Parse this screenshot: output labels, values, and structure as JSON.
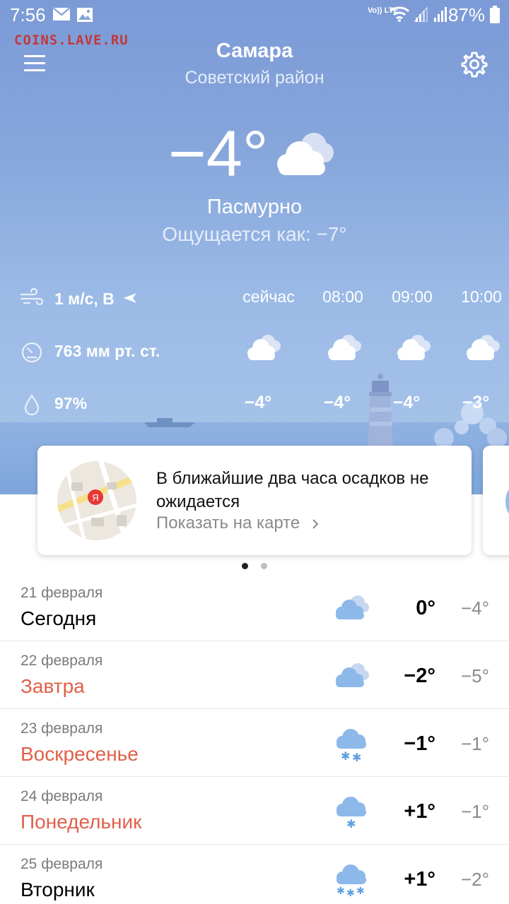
{
  "status_bar": {
    "time": "7:56",
    "lte_label": "Vo)) LTE",
    "battery_text": "87%",
    "icons": [
      "mail-icon",
      "image-icon",
      "wifi-icon",
      "signal-icon",
      "battery-icon"
    ]
  },
  "watermark": "COINS.LAVE.RU",
  "header": {
    "city": "Самара",
    "district": "Советский район"
  },
  "current": {
    "temperature": "−4°",
    "condition": "Пасмурно",
    "feels_like": "Ощущается как: −7°",
    "wind": "1 м/с, В",
    "pressure": "763 мм рт. ст.",
    "humidity": "97%"
  },
  "hourly": [
    {
      "label": "сейчас",
      "temp": "−4°",
      "icon": "cloudy-icon"
    },
    {
      "label": "08:00",
      "temp": "−4°",
      "icon": "cloudy-icon"
    },
    {
      "label": "09:00",
      "temp": "−4°",
      "icon": "cloudy-icon"
    },
    {
      "label": "10:00",
      "temp": "−3°",
      "icon": "cloudy-icon"
    }
  ],
  "precip_card": {
    "text": "В ближайшие два часа осадков не ожидается",
    "link": "Показать на карте",
    "map_pin": "Я"
  },
  "pager": {
    "active_index": 0,
    "count": 2
  },
  "forecast": [
    {
      "date": "21 февраля",
      "name": "Сегодня",
      "hi": "0°",
      "lo": "−4°",
      "weekend": false,
      "icon": "cloudy-icon"
    },
    {
      "date": "22 февраля",
      "name": "Завтра",
      "hi": "−2°",
      "lo": "−5°",
      "weekend": true,
      "icon": "cloudy-icon"
    },
    {
      "date": "23 февраля",
      "name": "Воскресенье",
      "hi": "−1°",
      "lo": "−1°",
      "weekend": true,
      "icon": "snow-icon"
    },
    {
      "date": "24 февраля",
      "name": "Понедельник",
      "hi": "+1°",
      "lo": "−1°",
      "weekend": true,
      "icon": "light-snow-icon"
    },
    {
      "date": "25 февраля",
      "name": "Вторник",
      "hi": "+1°",
      "lo": "−2°",
      "weekend": false,
      "icon": "heavy-snow-icon"
    }
  ],
  "colors": {
    "weekend": "#e0604a",
    "sky_top": "#7c9ad6",
    "accent_pin": "#e53935",
    "dot_active": "#222222",
    "dot_inactive": "#bdbdbd"
  }
}
